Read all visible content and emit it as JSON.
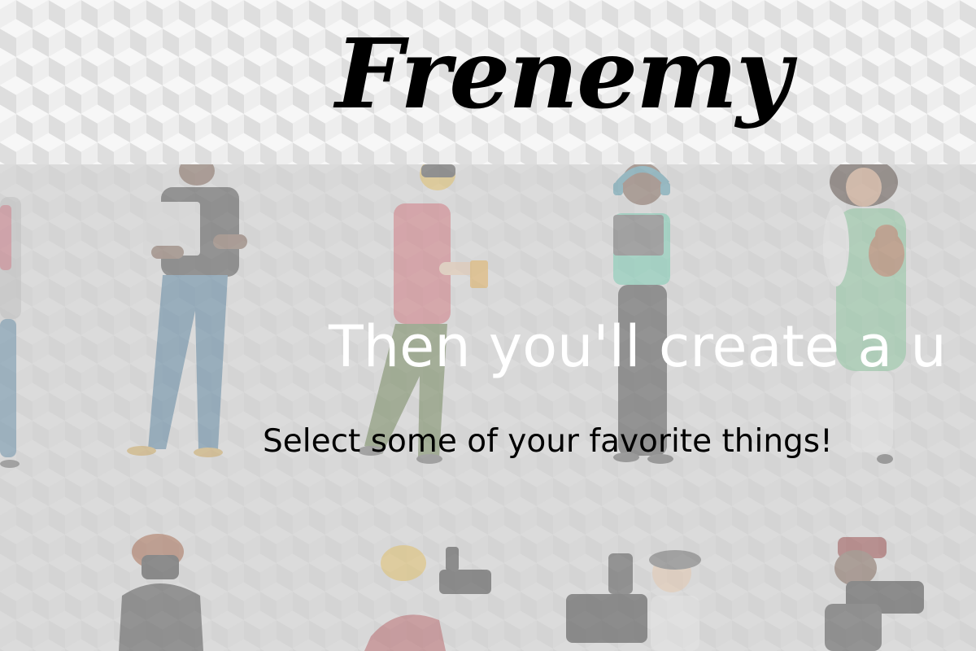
{
  "app": {
    "logo_text": "Frenemy"
  },
  "onboarding": {
    "headline": "Then you'll create a u",
    "subheadline": "Select some of your favorite things!"
  },
  "colors": {
    "logo": "#000000",
    "headline": "#ffffff",
    "subheadline": "#000000",
    "header_bg": "#eeeeee",
    "scene_bg": "#d8d8d8"
  },
  "illustration": {
    "description_icons": [
      "people-illustration-icon",
      "camera-crew-illustration-icon"
    ]
  }
}
